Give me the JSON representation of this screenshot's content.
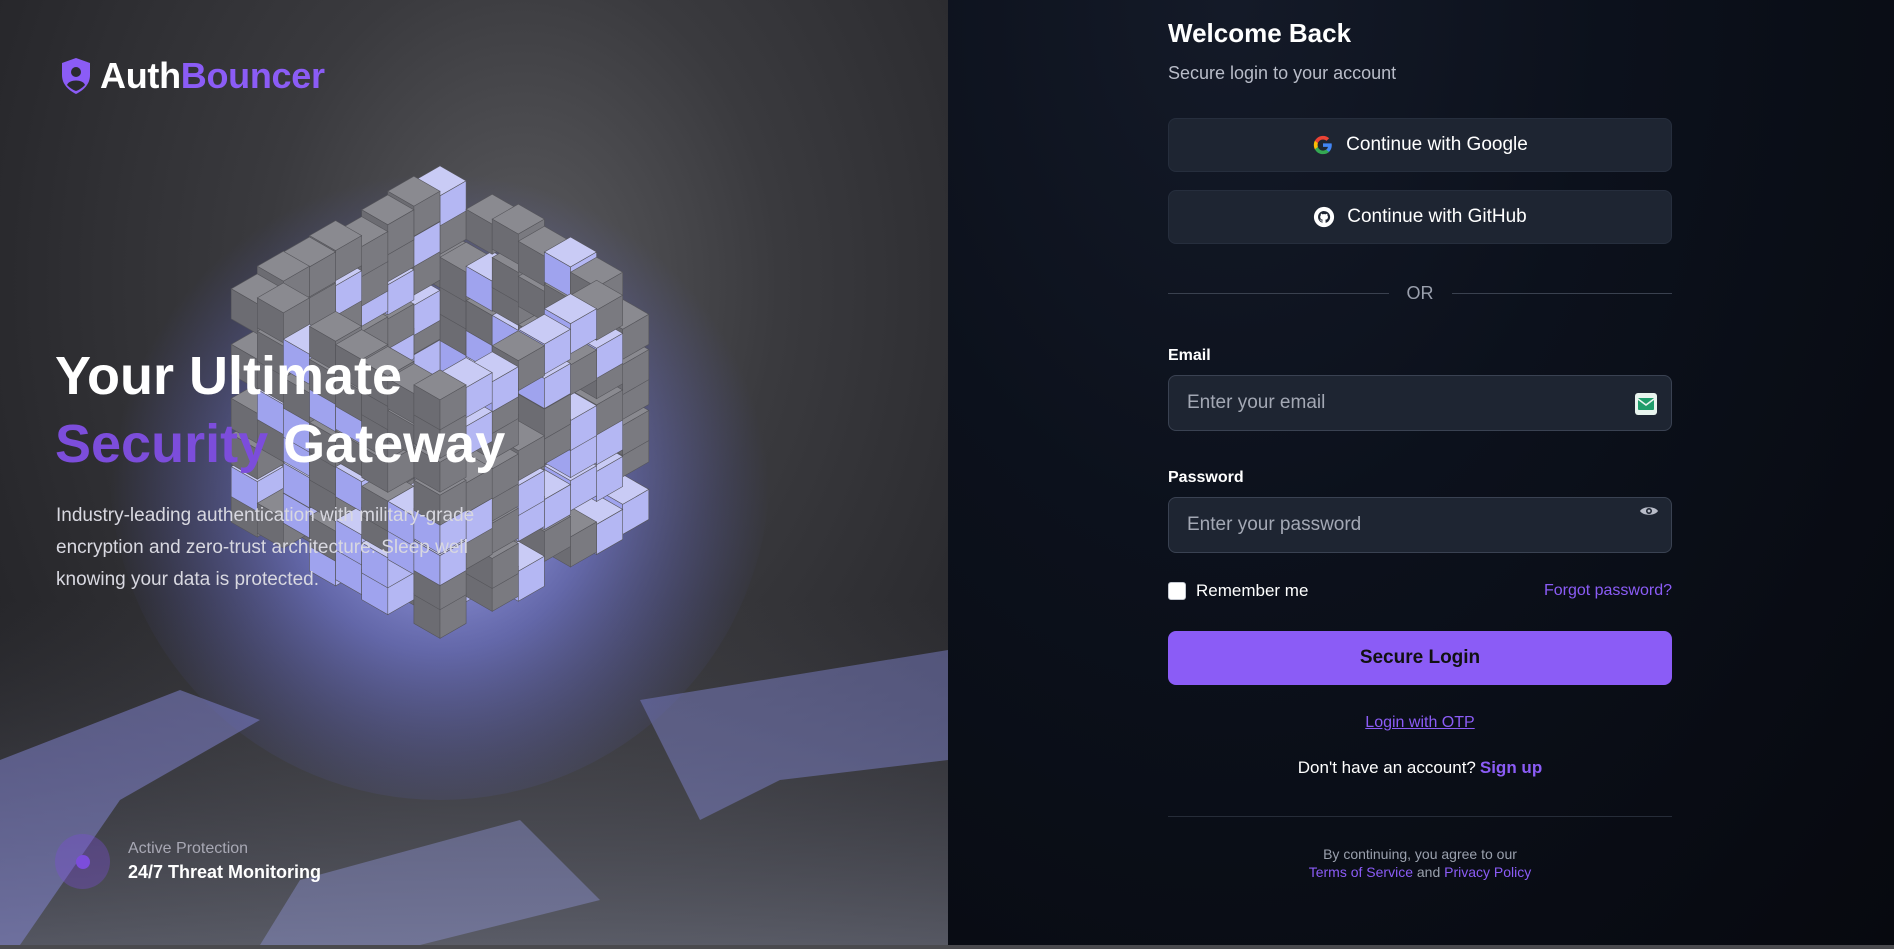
{
  "brand": {
    "name_part1": "Auth",
    "name_part2": "Bouncer",
    "accent": "#8b5cf6"
  },
  "hero": {
    "headline_line1": "Your Ultimate",
    "headline_accent": "Security",
    "headline_line2_rest": "Gateway",
    "description": "Industry-leading authentication with military-grade encryption and zero-trust architecture. Sleep well knowing your data is protected.",
    "status_label": "Active Protection",
    "status_value": "24/7 Threat Monitoring"
  },
  "login": {
    "title": "Welcome Back",
    "subtitle": "Secure login to your account",
    "google_label": "Continue with Google",
    "github_label": "Continue with GitHub",
    "divider_text": "OR",
    "email_label": "Email",
    "email_placeholder": "Enter your email",
    "password_label": "Password",
    "password_placeholder": "Enter your password",
    "remember_label": "Remember me",
    "forgot_label": "Forgot password?",
    "submit_label": "Secure Login",
    "otp_label": "Login with OTP",
    "signup_prompt": "Don't have an account?",
    "signup_link": "Sign up",
    "footer_line1": "By continuing, you agree to our",
    "terms_label": "Terms of Service",
    "footer_and": "and",
    "privacy_label": "Privacy Policy"
  },
  "colors": {
    "accent": "#8b5cf6",
    "panel_bg": "#0c111c",
    "input_bg": "#1e2532"
  },
  "icons": [
    "shield-user-icon",
    "google-icon",
    "github-icon",
    "mail-icon",
    "eye-icon"
  ]
}
